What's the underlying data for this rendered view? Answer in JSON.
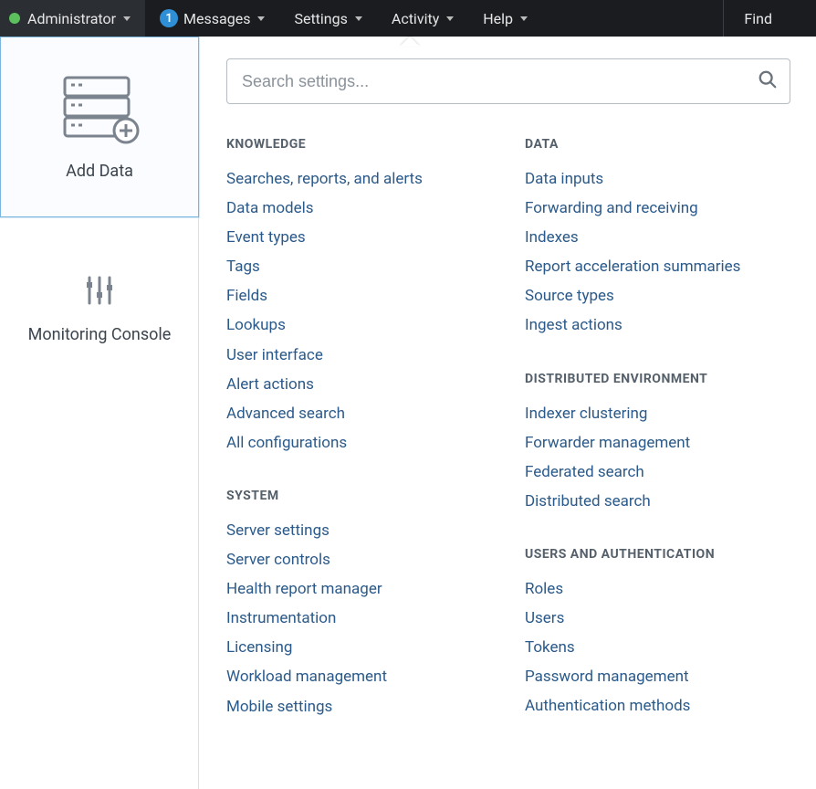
{
  "topbar": {
    "administrator": "Administrator",
    "messages_badge": "1",
    "messages": "Messages",
    "settings": "Settings",
    "activity": "Activity",
    "help": "Help",
    "find": "Find"
  },
  "sidebar": {
    "add_data": "Add Data",
    "monitoring_console": "Monitoring Console"
  },
  "search": {
    "placeholder": "Search settings..."
  },
  "sections": {
    "knowledge": {
      "title": "KNOWLEDGE",
      "items": [
        "Searches, reports, and alerts",
        "Data models",
        "Event types",
        "Tags",
        "Fields",
        "Lookups",
        "User interface",
        "Alert actions",
        "Advanced search",
        "All configurations"
      ]
    },
    "system": {
      "title": "SYSTEM",
      "items": [
        "Server settings",
        "Server controls",
        "Health report manager",
        "Instrumentation",
        "Licensing",
        "Workload management",
        "Mobile settings"
      ]
    },
    "data": {
      "title": "DATA",
      "items": [
        "Data inputs",
        "Forwarding and receiving",
        "Indexes",
        "Report acceleration summaries",
        "Source types",
        "Ingest actions"
      ]
    },
    "distributed": {
      "title": "DISTRIBUTED ENVIRONMENT",
      "items": [
        "Indexer clustering",
        "Forwarder management",
        "Federated search",
        "Distributed search"
      ]
    },
    "users": {
      "title": "USERS AND AUTHENTICATION",
      "items": [
        "Roles",
        "Users",
        "Tokens",
        "Password management",
        "Authentication methods"
      ]
    }
  }
}
